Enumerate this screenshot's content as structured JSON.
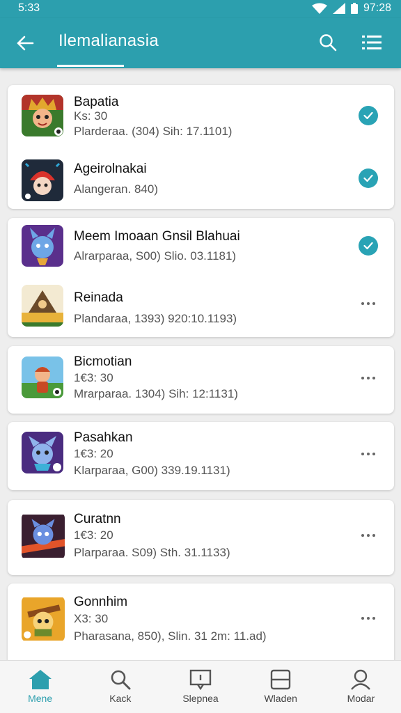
{
  "status_bar": {
    "time": "5:33",
    "battery_time": "97:28"
  },
  "app_bar": {
    "title": "Ilemalianasia"
  },
  "cards": [
    {
      "items": [
        {
          "name": "Bapatia",
          "line1": "Ks: 30",
          "line2": "Plarderaa. (304) Sih: 17.1101)",
          "action": "check"
        },
        {
          "name": "Ageirolnakai",
          "line1": "Alangeran. 840)",
          "line2": "",
          "action": "check"
        }
      ]
    },
    {
      "items": [
        {
          "name": "Meem Imoaan Gnsil Blahuai",
          "line1": "Alrarparaa, S00) Slio. 03.1181)",
          "line2": "",
          "action": "check"
        },
        {
          "name": "Reinada",
          "line1": "Plandaraa, 1393) 920:10.1193)",
          "line2": "",
          "action": "more"
        }
      ]
    },
    {
      "items": [
        {
          "name": "Bicmotian",
          "line1": "1€3: 30",
          "line2": "Mrarparaa. 1304) Sih: 12:1131)",
          "action": "more"
        }
      ]
    },
    {
      "items": [
        {
          "name": "Pasahkan",
          "line1": "1€3: 20",
          "line2": "Klarparaa, G00) 339.19.1131)",
          "action": "more"
        }
      ]
    },
    {
      "items": [
        {
          "name": "Curatnn",
          "line1": "1€3: 20",
          "line2": "Plarparaa. S09) Sth. 31.1133)",
          "action": "more"
        }
      ]
    },
    {
      "items": [
        {
          "name": "Gonnhim",
          "line1": "X3: 30",
          "line2": "Pharasana, 850), Slin. 31 2m: 11.ad)",
          "action": "more"
        }
      ]
    }
  ],
  "bottom_nav": [
    {
      "label": "Mene",
      "icon": "home-icon",
      "active": true
    },
    {
      "label": "Kack",
      "icon": "search-icon",
      "active": false
    },
    {
      "label": "Slepnea",
      "icon": "comment-icon",
      "active": false
    },
    {
      "label": "Wladen",
      "icon": "window-icon",
      "active": false
    },
    {
      "label": "Modar",
      "icon": "profile-icon",
      "active": false
    }
  ],
  "colors": {
    "accent": "#2c9fae",
    "check": "#29a3b5"
  }
}
